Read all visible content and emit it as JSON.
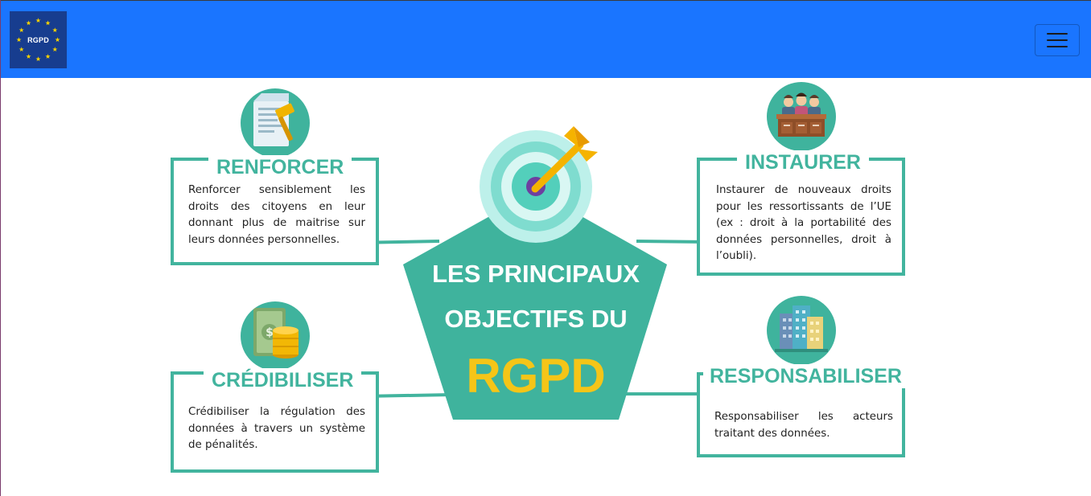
{
  "navbar": {
    "brand_label": "RGPD",
    "brand_color": "#173d8f",
    "background_color": "#1a75ff",
    "menu_icon": "hamburger-menu-icon"
  },
  "infographic": {
    "accent_color": "#42b49e",
    "highlight_color": "#f5c518",
    "center": {
      "line1": "LES PRINCIPAUX",
      "line2": "OBJECTIFS DU",
      "big": "RGPD",
      "icon": "target-dart-icon"
    },
    "objectives": [
      {
        "title": "RENFORCER",
        "text": "Renforcer sensiblement les droits des citoyens en leur donnant plus de maitrise sur leurs données personnelles.",
        "icon": "document-gavel-icon"
      },
      {
        "title": "INSTAURER",
        "text": "Instaurer de nouveaux droits pour les ressortissants de l’UE (ex : droit à la portabilité des données personnelles, droit à l’oubli).",
        "icon": "tribunal-judges-icon"
      },
      {
        "title": "CRÉDIBILISER",
        "text": "Crédibiliser la régulation des données à travers un système de pénalités.",
        "icon": "money-coins-icon"
      },
      {
        "title": "RESPONSABILISER",
        "text": "Responsabiliser les acteurs traitant des données.",
        "icon": "office-buildings-icon"
      }
    ]
  }
}
